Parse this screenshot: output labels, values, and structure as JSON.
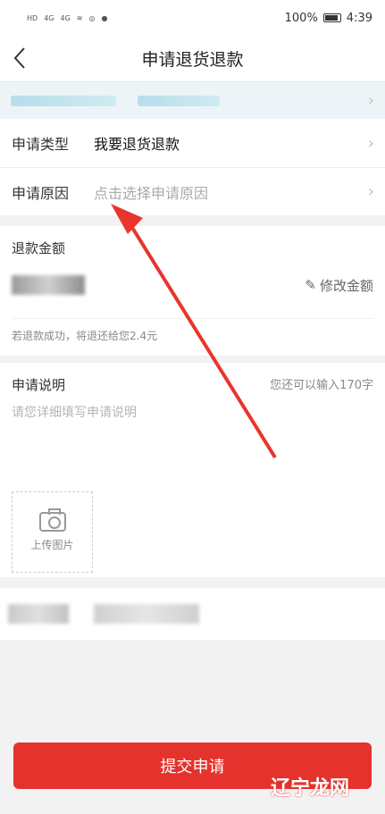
{
  "status_bar": {
    "left_icons": [
      "HD",
      "4G",
      "4G",
      "wifi-icon",
      "camera-icon",
      "chat-icon"
    ],
    "battery_text": "100%",
    "time": "4:39"
  },
  "header": {
    "title": "申请退货退款",
    "back_icon": "chevron-left-icon"
  },
  "form": {
    "type_label": "申请类型",
    "type_value": "我要退货退款",
    "reason_label": "申请原因",
    "reason_placeholder": "点击选择申请原因"
  },
  "refund": {
    "label": "退款金额",
    "edit_label": "修改金额",
    "note": "若退款成功，将退还给您2.4元"
  },
  "explain": {
    "label": "申请说明",
    "counter": "您还可以输入170字",
    "placeholder": "请您详细填写申请说明",
    "upload_label": "上传图片"
  },
  "submit_label": "提交申请",
  "watermark": "辽宁龙网",
  "colors": {
    "accent": "#e5322d",
    "arrow": "#e8352e"
  }
}
